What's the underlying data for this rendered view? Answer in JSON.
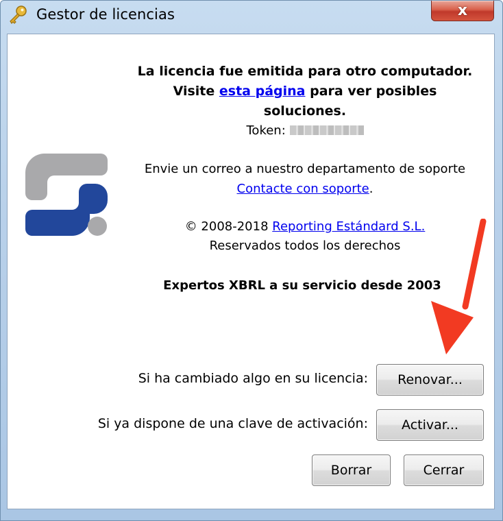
{
  "window": {
    "title": "Gestor de licencias",
    "close_label": "x"
  },
  "message": {
    "line1": "La licencia fue emitida para otro computador.",
    "visit_prefix": "Visite ",
    "visit_link": "esta página",
    "visit_suffix": " para ver posibles",
    "line3": "soluciones.",
    "token_label": "Token: "
  },
  "support": {
    "line1": "Envie un correo a nuestro departamento de soporte",
    "link": "Contacte con soporte",
    "link_suffix": "."
  },
  "copyright": {
    "prefix": "© 2008-2018 ",
    "company_link": "Reporting Estándard S.L.",
    "rights": "Reservados todos los derechos"
  },
  "slogan": "Expertos XBRL a su servicio desde 2003",
  "actions": {
    "renew_label": "Si ha cambiado algo en su licencia:",
    "renew_button": "Renovar...",
    "activate_label": "Si ya dispone de una clave de activación:",
    "activate_button": "Activar...",
    "delete_button": "Borrar",
    "close_button": "Cerrar"
  },
  "colors": {
    "logo_gray": "#a9a9ab",
    "logo_blue": "#22479b",
    "annotation_arrow": "#f23a22",
    "link": "#0000ee"
  },
  "icons": {
    "title": "key-icon",
    "annotation": "red-arrow-annotation"
  }
}
